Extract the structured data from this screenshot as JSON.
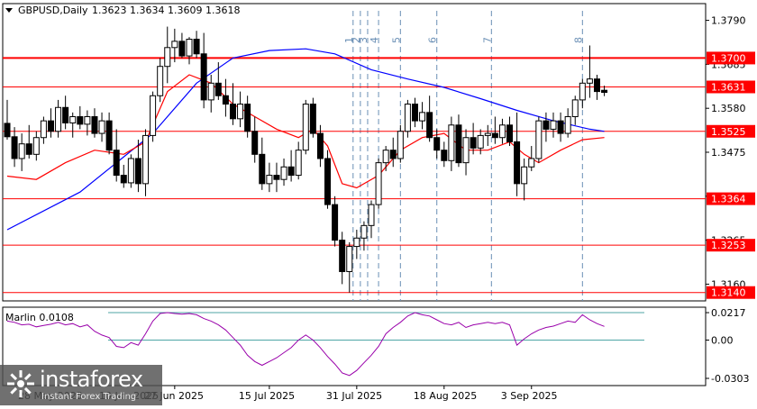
{
  "header": {
    "symbol": "GBPUSD,Daily",
    "ohlc": "1.3623 1.3634 1.3609 1.3618"
  },
  "chart_data": [
    {
      "type": "candlestick",
      "symbol": "GBPUSD",
      "timeframe": "Daily",
      "ylim": [
        1.312,
        1.383
      ],
      "y_ticks": [
        1.316,
        1.3265,
        1.337,
        1.3475,
        1.358,
        1.3685,
        1.379
      ],
      "y_tick_labels": [
        "1.3160",
        "1.3265",
        "1.3370",
        "1.3475",
        "1.3580",
        "1.3685",
        "1.3790"
      ],
      "x_labels": [
        {
          "label": "27 Jun 2025",
          "index": 23
        },
        {
          "label": "15 Jul 2025",
          "index": 36
        },
        {
          "label": "31 Jul 2025",
          "index": 48
        },
        {
          "label": "18 Aug 2025",
          "index": 60
        },
        {
          "label": "3 Sep 2025",
          "index": 72
        }
      ],
      "grid": false,
      "horizontal_levels": [
        {
          "value": 1.37,
          "label": "1.3700",
          "color": "#ff0000",
          "weight": "thick"
        },
        {
          "value": 1.3631,
          "label": "1.3631",
          "color": "#ff0000",
          "weight": "thin"
        },
        {
          "value": 1.3525,
          "label": "1.3525",
          "color": "#ff0000",
          "weight": "thin"
        },
        {
          "value": 1.3364,
          "label": "1.3364",
          "color": "#ff0000",
          "weight": "thin"
        },
        {
          "value": 1.3253,
          "label": "1.3253",
          "color": "#ff0000",
          "weight": "thin"
        },
        {
          "value": 1.314,
          "label": "1.3140",
          "color": "#ff0000",
          "weight": "thin"
        }
      ],
      "vertical_markers": [
        {
          "index": 47.5,
          "label": "1"
        },
        {
          "index": 48.5,
          "label": "2"
        },
        {
          "index": 49.5,
          "label": "3"
        },
        {
          "index": 51,
          "label": "4"
        },
        {
          "index": 54,
          "label": "5"
        },
        {
          "index": 59,
          "label": "6"
        },
        {
          "index": 66.5,
          "label": "7"
        },
        {
          "index": 79,
          "label": "8"
        }
      ],
      "candles": [
        [
          1.3544,
          1.36,
          1.3505,
          1.3512
        ],
        [
          1.3512,
          1.3535,
          1.344,
          1.346
        ],
        [
          1.346,
          1.352,
          1.343,
          1.3495
        ],
        [
          1.3495,
          1.354,
          1.346,
          1.347
        ],
        [
          1.347,
          1.3525,
          1.3455,
          1.351
        ],
        [
          1.351,
          1.356,
          1.3495,
          1.355
        ],
        [
          1.355,
          1.358,
          1.351,
          1.3525
        ],
        [
          1.3525,
          1.36,
          1.351,
          1.3582
        ],
        [
          1.3582,
          1.361,
          1.353,
          1.3545
        ],
        [
          1.3545,
          1.357,
          1.351,
          1.356
        ],
        [
          1.356,
          1.3585,
          1.353,
          1.3542
        ],
        [
          1.3542,
          1.3575,
          1.3515,
          1.356
        ],
        [
          1.356,
          1.358,
          1.351,
          1.352
        ],
        [
          1.352,
          1.357,
          1.35,
          1.355
        ],
        [
          1.355,
          1.357,
          1.347,
          1.348
        ],
        [
          1.348,
          1.353,
          1.3405,
          1.342
        ],
        [
          1.342,
          1.3445,
          1.339,
          1.3402
        ],
        [
          1.3402,
          1.347,
          1.339,
          1.346
        ],
        [
          1.346,
          1.3505,
          1.338,
          1.34
        ],
        [
          1.34,
          1.353,
          1.337,
          1.3515
        ],
        [
          1.3515,
          1.362,
          1.35,
          1.361
        ],
        [
          1.361,
          1.37,
          1.3595,
          1.368
        ],
        [
          1.368,
          1.3775,
          1.364,
          1.3725
        ],
        [
          1.3725,
          1.377,
          1.369,
          1.374
        ],
        [
          1.374,
          1.376,
          1.37,
          1.3705
        ],
        [
          1.3705,
          1.375,
          1.3685,
          1.3745
        ],
        [
          1.3745,
          1.3765,
          1.37,
          1.371
        ],
        [
          1.371,
          1.376,
          1.358,
          1.36
        ],
        [
          1.36,
          1.366,
          1.357,
          1.364
        ],
        [
          1.364,
          1.369,
          1.36,
          1.361
        ],
        [
          1.361,
          1.365,
          1.356,
          1.359
        ],
        [
          1.359,
          1.364,
          1.354,
          1.3555
        ],
        [
          1.3555,
          1.362,
          1.3535,
          1.359
        ],
        [
          1.359,
          1.361,
          1.351,
          1.3525
        ],
        [
          1.3525,
          1.356,
          1.345,
          1.347
        ],
        [
          1.347,
          1.351,
          1.3385,
          1.34
        ],
        [
          1.34,
          1.345,
          1.338,
          1.342
        ],
        [
          1.342,
          1.345,
          1.338,
          1.341
        ],
        [
          1.341,
          1.346,
          1.3395,
          1.344
        ],
        [
          1.344,
          1.348,
          1.3405,
          1.342
        ],
        [
          1.342,
          1.35,
          1.341,
          1.348
        ],
        [
          1.348,
          1.36,
          1.347,
          1.359
        ],
        [
          1.359,
          1.3605,
          1.351,
          1.352
        ],
        [
          1.352,
          1.354,
          1.344,
          1.346
        ],
        [
          1.346,
          1.348,
          1.334,
          1.335
        ],
        [
          1.335,
          1.337,
          1.325,
          1.3265
        ],
        [
          1.3265,
          1.3285,
          1.316,
          1.319
        ],
        [
          1.319,
          1.326,
          1.314,
          1.325
        ],
        [
          1.325,
          1.329,
          1.322,
          1.327
        ],
        [
          1.327,
          1.331,
          1.324,
          1.33
        ],
        [
          1.33,
          1.336,
          1.327,
          1.335
        ],
        [
          1.335,
          1.346,
          1.334,
          1.345
        ],
        [
          1.345,
          1.349,
          1.343,
          1.348
        ],
        [
          1.348,
          1.351,
          1.344,
          1.346
        ],
        [
          1.346,
          1.354,
          1.345,
          1.3525
        ],
        [
          1.3525,
          1.36,
          1.351,
          1.359
        ],
        [
          1.359,
          1.3605,
          1.3535,
          1.355
        ],
        [
          1.355,
          1.3595,
          1.353,
          1.357
        ],
        [
          1.357,
          1.361,
          1.35,
          1.351
        ],
        [
          1.351,
          1.353,
          1.346,
          1.348
        ],
        [
          1.348,
          1.35,
          1.344,
          1.3455
        ],
        [
          1.3455,
          1.356,
          1.343,
          1.354
        ],
        [
          1.354,
          1.3565,
          1.344,
          1.345
        ],
        [
          1.345,
          1.353,
          1.342,
          1.351
        ],
        [
          1.351,
          1.3545,
          1.347,
          1.3485
        ],
        [
          1.3485,
          1.353,
          1.347,
          1.3515
        ],
        [
          1.3515,
          1.354,
          1.349,
          1.352
        ],
        [
          1.352,
          1.356,
          1.3495,
          1.351
        ],
        [
          1.351,
          1.3555,
          1.3495,
          1.354
        ],
        [
          1.354,
          1.356,
          1.349,
          1.35
        ],
        [
          1.35,
          1.357,
          1.337,
          1.34
        ],
        [
          1.34,
          1.346,
          1.336,
          1.344
        ],
        [
          1.344,
          1.349,
          1.343,
          1.346
        ],
        [
          1.346,
          1.356,
          1.345,
          1.355
        ],
        [
          1.355,
          1.357,
          1.35,
          1.353
        ],
        [
          1.353,
          1.357,
          1.351,
          1.355
        ],
        [
          1.355,
          1.357,
          1.35,
          1.352
        ],
        [
          1.352,
          1.358,
          1.351,
          1.356
        ],
        [
          1.356,
          1.361,
          1.354,
          1.36
        ],
        [
          1.36,
          1.365,
          1.358,
          1.364
        ],
        [
          1.364,
          1.373,
          1.3605,
          1.365
        ],
        [
          1.365,
          1.366,
          1.36,
          1.362
        ],
        [
          1.3623,
          1.3634,
          1.3609,
          1.3618
        ]
      ],
      "series": [
        {
          "color": "#0000ff",
          "role": "long moving average",
          "points": [
            [
              0,
              1.329
            ],
            [
              10,
              1.338
            ],
            [
              20,
              1.352
            ],
            [
              26,
              1.364
            ],
            [
              31,
              1.37
            ],
            [
              36,
              1.3718
            ],
            [
              41,
              1.3722
            ],
            [
              45,
              1.371
            ],
            [
              50,
              1.3672
            ],
            [
              55,
              1.365
            ],
            [
              60,
              1.363
            ],
            [
              65,
              1.3603
            ],
            [
              70,
              1.3575
            ],
            [
              75,
              1.355
            ],
            [
              80,
              1.353
            ],
            [
              82,
              1.3525
            ]
          ]
        },
        {
          "color": "#ff0000",
          "role": "short moving average",
          "points": [
            [
              0,
              1.3418
            ],
            [
              4,
              1.341
            ],
            [
              8,
              1.345
            ],
            [
              12,
              1.348
            ],
            [
              16,
              1.347
            ],
            [
              19,
              1.35
            ],
            [
              22,
              1.362
            ],
            [
              25,
              1.366
            ],
            [
              28,
              1.364
            ],
            [
              31,
              1.359
            ],
            [
              34,
              1.356
            ],
            [
              37,
              1.353
            ],
            [
              40,
              1.351
            ],
            [
              42,
              1.353
            ],
            [
              44,
              1.349
            ],
            [
              46,
              1.34
            ],
            [
              48,
              1.339
            ],
            [
              51,
              1.342
            ],
            [
              54,
              1.348
            ],
            [
              57,
              1.351
            ],
            [
              60,
              1.352
            ],
            [
              63,
              1.348
            ],
            [
              66,
              1.348
            ],
            [
              69,
              1.35
            ],
            [
              71,
              1.347
            ],
            [
              73,
              1.345
            ],
            [
              76,
              1.348
            ],
            [
              79,
              1.3505
            ],
            [
              82,
              1.351
            ]
          ]
        }
      ],
      "indicator": {
        "name": "Marlin",
        "value": "0.0108",
        "ylim": [
          -0.036,
          0.026
        ],
        "y_tick_labels": [
          "0.0217",
          "0.00",
          "-0.0303"
        ],
        "levels": [
          {
            "value": 0.0217,
            "color": "#4fa6a6"
          },
          {
            "value": 0.0,
            "color": "#4fa6a6"
          }
        ],
        "line_color": "#9900aa",
        "values": [
          0.015,
          0.014,
          0.012,
          0.0125,
          0.0105,
          0.0115,
          0.0125,
          0.014,
          0.012,
          0.013,
          0.0105,
          0.012,
          0.007,
          0.004,
          0.002,
          -0.005,
          -0.006,
          -0.002,
          -0.004,
          0.005,
          0.015,
          0.021,
          0.0217,
          0.021,
          0.0205,
          0.021,
          0.02,
          0.017,
          0.015,
          0.012,
          0.008,
          0.002,
          -0.004,
          -0.012,
          -0.017,
          -0.02,
          -0.017,
          -0.014,
          -0.01,
          -0.006,
          0.0,
          0.004,
          0.0,
          -0.006,
          -0.013,
          -0.019,
          -0.026,
          -0.028,
          -0.024,
          -0.018,
          -0.012,
          -0.005,
          0.005,
          0.01,
          0.014,
          0.019,
          0.0217,
          0.02,
          0.019,
          0.016,
          0.013,
          0.012,
          0.014,
          0.01,
          0.012,
          0.013,
          0.014,
          0.013,
          0.014,
          0.012,
          -0.004,
          0.001,
          0.005,
          0.008,
          0.01,
          0.011,
          0.013,
          0.015,
          0.014,
          0.02,
          0.016,
          0.013,
          0.0108
        ]
      }
    }
  ],
  "x_labels_partial": [
    "28 May 2025",
    "10 Jun 2025"
  ],
  "watermark": {
    "brand": "instaforex",
    "tagline": "Instant Forex Trading"
  },
  "colors": {
    "level_line": "#ff0000",
    "label_bg": "#ff0000",
    "label_text": "#ffffff",
    "axis_text": "#000000",
    "marker_line": "#6a8fb5",
    "ma_fast": "#ff0000",
    "ma_slow": "#0000ff"
  }
}
